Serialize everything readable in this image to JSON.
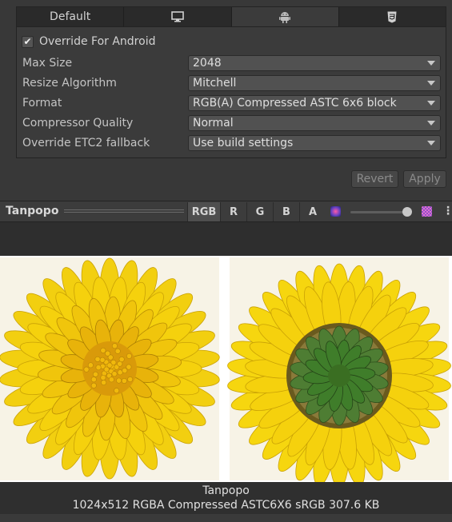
{
  "tabs": [
    {
      "label": "Default",
      "icon": null
    },
    {
      "label": "",
      "icon": "monitor-icon"
    },
    {
      "label": "",
      "icon": "android-icon"
    },
    {
      "label": "",
      "icon": "html5-icon"
    }
  ],
  "override": {
    "checked": true,
    "label": "Override For Android"
  },
  "fields": [
    {
      "label": "Max Size",
      "value": "2048"
    },
    {
      "label": "Resize Algorithm",
      "value": "Mitchell"
    },
    {
      "label": "Format",
      "value": "RGB(A) Compressed ASTC 6x6 block"
    },
    {
      "label": "Compressor Quality",
      "value": "Normal"
    },
    {
      "label": "Override ETC2 fallback",
      "value": "Use build settings"
    }
  ],
  "buttons": {
    "revert": "Revert",
    "apply": "Apply"
  },
  "preview": {
    "title": "Tanpopo",
    "channels": [
      "RGB",
      "R",
      "G",
      "B",
      "A"
    ],
    "active_channel": "RGB",
    "mip_level": 0.98
  },
  "info": {
    "name": "Tanpopo",
    "details": "1024x512  RGBA Compressed ASTC6X6 sRGB   307.6 KB"
  },
  "colors": {
    "petal_yellow": "#f5d10d",
    "flower_center": "#d99a0a",
    "sepal_green": "#3f7d2a"
  }
}
